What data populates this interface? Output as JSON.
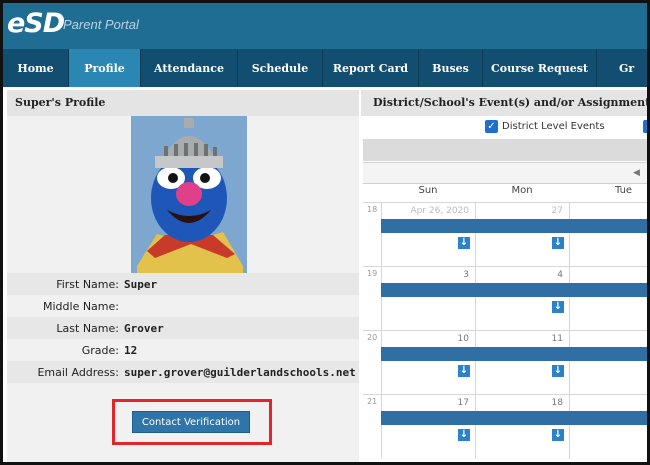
{
  "app": {
    "logo": "eSD",
    "subtitle": "Parent Portal"
  },
  "nav": [
    {
      "label": "Home"
    },
    {
      "label": "Profile",
      "active": true
    },
    {
      "label": "Attendance"
    },
    {
      "label": "Schedule"
    },
    {
      "label": "Report Card"
    },
    {
      "label": "Buses"
    },
    {
      "label": "Course Request"
    },
    {
      "label": "Gr"
    }
  ],
  "profile": {
    "heading": "Super's Profile",
    "fields": [
      {
        "label": "First Name:",
        "value": "Super"
      },
      {
        "label": "Middle Name:",
        "value": ""
      },
      {
        "label": "Last Name:",
        "value": "Grover"
      },
      {
        "label": "Grade:",
        "value": "12"
      },
      {
        "label": "Email Address:",
        "value": "super.grover@guilderlandschools.net"
      }
    ],
    "button": "Contact Verification"
  },
  "events": {
    "heading": "District/School's Event(s) and/or Assignment(",
    "filters": [
      {
        "label": "District Level Events",
        "checked": true
      }
    ],
    "days_of_week": [
      "Sun",
      "Mon",
      "Tue"
    ],
    "weeks": [
      {
        "week": "18",
        "days": [
          "Apr 26, 2020",
          "27",
          ""
        ]
      },
      {
        "week": "19",
        "days": [
          "3",
          "4",
          ""
        ]
      },
      {
        "week": "20",
        "days": [
          "10",
          "11",
          ""
        ]
      },
      {
        "week": "21",
        "days": [
          "17",
          "18",
          ""
        ]
      }
    ]
  },
  "colors": {
    "header": "#1f6d92",
    "nav": "#124e6f",
    "active_tab": "#2a86b3",
    "event": "#2f6fa4",
    "highlight": "#e0262a"
  }
}
